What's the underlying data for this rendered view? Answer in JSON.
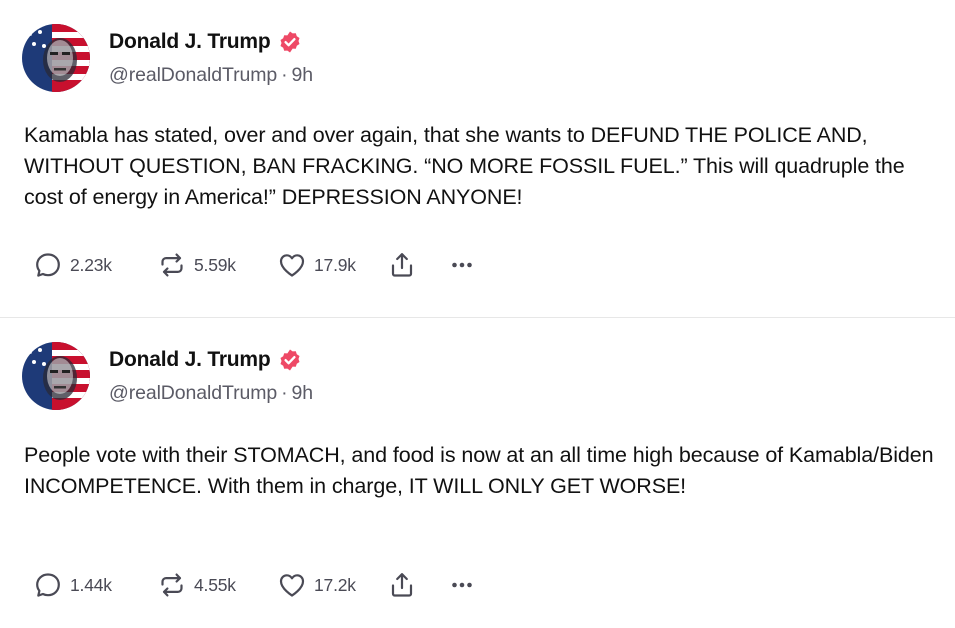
{
  "posts": [
    {
      "author": {
        "display_name": "Donald J. Trump",
        "handle": "@realDonaldTrump",
        "time": "9h",
        "verified": true
      },
      "text": "Kamabla has stated, over and over again, that she wants to DEFUND THE POLICE AND, WITHOUT QUESTION, BAN FRACKING. “NO MORE FOSSIL FUEL.” This will quadruple the cost of energy in America!” DEPRESSION ANYONE!",
      "stats": {
        "replies": "2.23k",
        "reposts": "5.59k",
        "likes": "17.9k"
      }
    },
    {
      "author": {
        "display_name": "Donald J. Trump",
        "handle": "@realDonaldTrump",
        "time": "9h",
        "verified": true
      },
      "text": "People vote with their STOMACH, and food is now at an all time high because of Kamabla/Biden INCOMPETENCE. With them in charge, IT WILL ONLY GET WORSE!",
      "stats": {
        "replies": "1.44k",
        "reposts": "4.55k",
        "likes": "17.2k"
      }
    }
  ],
  "icons": {
    "verified": "verified-badge-icon",
    "reply": "reply-icon",
    "repost": "repost-icon",
    "like": "heart-icon",
    "share": "share-icon",
    "more": "more-options-icon"
  },
  "colors": {
    "verified_badge": "#ee4966",
    "icon_gray": "#4a4a55",
    "meta_gray": "#5b5b66",
    "divider": "#e7e7e7"
  }
}
